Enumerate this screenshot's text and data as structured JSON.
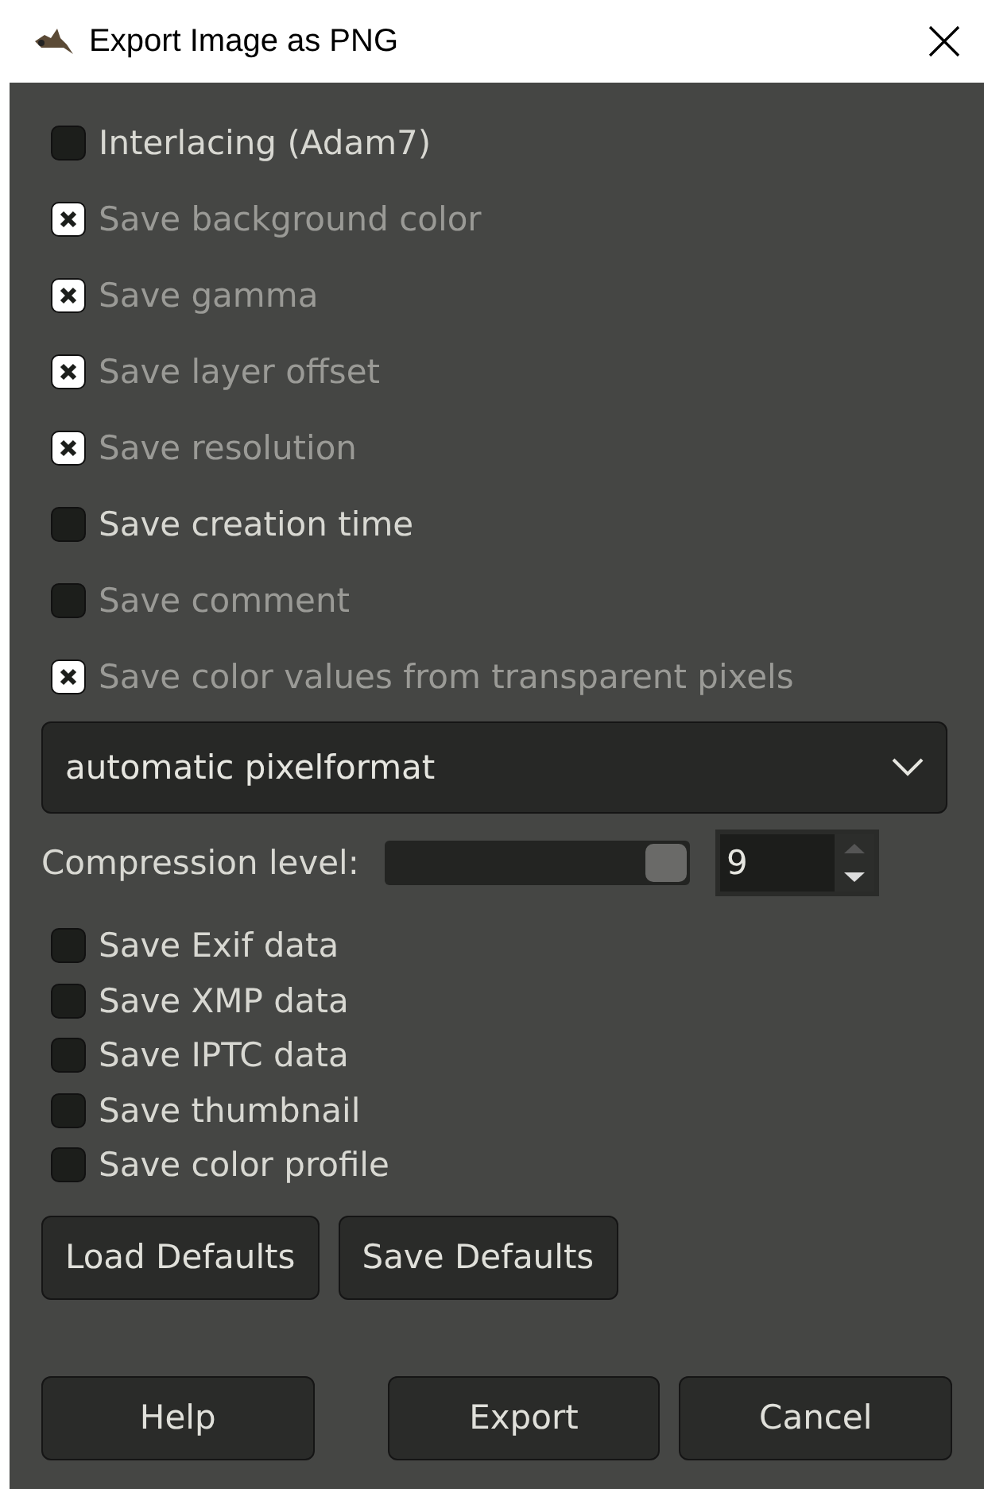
{
  "window": {
    "title": "Export Image as PNG"
  },
  "options": [
    {
      "label": "Interlacing (Adam7)",
      "checked": false,
      "disabled": false
    },
    {
      "label": "Save background color",
      "checked": true,
      "disabled": true
    },
    {
      "label": "Save gamma",
      "checked": true,
      "disabled": true
    },
    {
      "label": "Save layer offset",
      "checked": true,
      "disabled": true
    },
    {
      "label": "Save resolution",
      "checked": true,
      "disabled": true
    },
    {
      "label": "Save creation time",
      "checked": false,
      "disabled": false
    },
    {
      "label": "Save comment",
      "checked": false,
      "disabled": true
    },
    {
      "label": "Save color values from transparent pixels",
      "checked": true,
      "disabled": true
    }
  ],
  "pixelformat": {
    "value": "automatic pixelformat"
  },
  "compression": {
    "label": "Compression level:",
    "level": 1,
    "value": "9"
  },
  "metadata": [
    {
      "label": "Save Exif data",
      "checked": false
    },
    {
      "label": "Save XMP data",
      "checked": false
    },
    {
      "label": "Save IPTC data",
      "checked": false
    },
    {
      "label": "Save thumbnail",
      "checked": false
    },
    {
      "label": "Save color profile",
      "checked": false
    }
  ],
  "defaults_buttons": [
    "Load Defaults",
    "Save Defaults"
  ],
  "buttons": [
    "Help",
    "Export",
    "Cancel"
  ]
}
